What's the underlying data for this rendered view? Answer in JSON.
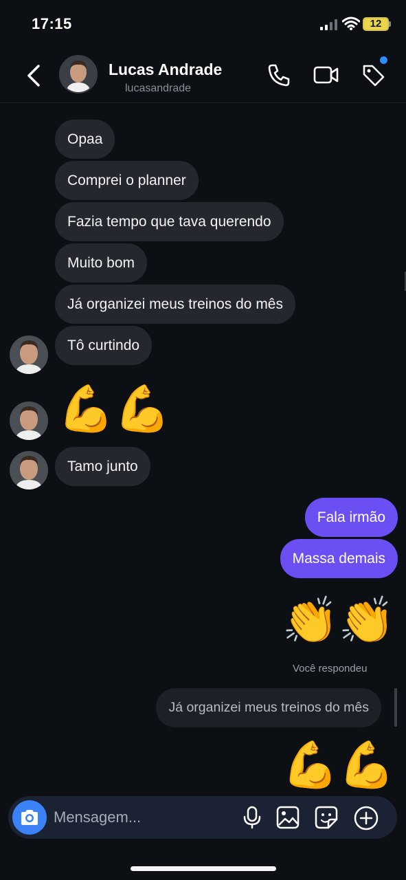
{
  "status_bar": {
    "time": "17:15",
    "battery": "12"
  },
  "header": {
    "name": "Lucas Andrade",
    "handle": "lucasandrade"
  },
  "messages": [
    {
      "text": "Opaa",
      "from": "them"
    },
    {
      "text": "Comprei o planner",
      "from": "them"
    },
    {
      "text": "Fazia tempo que tava querendo",
      "from": "them"
    },
    {
      "text": "Muito bom",
      "from": "them"
    },
    {
      "text": "Já organizei meus treinos do mês",
      "from": "them"
    },
    {
      "text": "Tô curtindo",
      "from": "them"
    },
    {
      "text": "💪💪",
      "from": "them",
      "kind": "emoji",
      "icon": "flexed-biceps"
    },
    {
      "text": "Tamo junto",
      "from": "them"
    },
    {
      "text": "Fala irmão",
      "from": "me"
    },
    {
      "text": "Massa demais",
      "from": "me"
    },
    {
      "text": "👏👏",
      "from": "me",
      "kind": "emoji",
      "icon": "clapping-hands"
    },
    {
      "text": "💪💪",
      "from": "me",
      "kind": "emoji",
      "icon": "flexed-biceps"
    }
  ],
  "reply": {
    "note": "Você respondeu",
    "quoted": "Já organizei meus treinos do mês"
  },
  "composer": {
    "placeholder": "Mensagem..."
  },
  "colors": {
    "background": "#0c0f14",
    "incoming_bubble": "#24272e",
    "outgoing_bubble": "#6b4ff2",
    "accent": "#3b82f6"
  }
}
